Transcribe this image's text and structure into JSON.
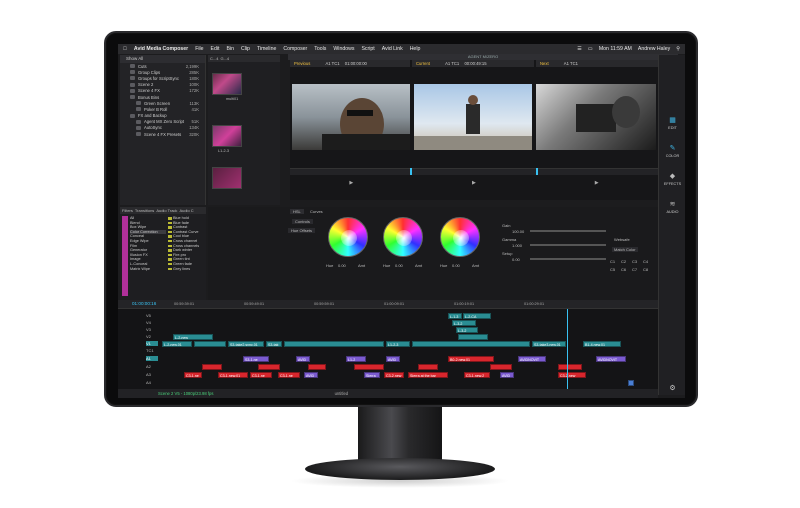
{
  "menu": {
    "app": "Avid Media Composer",
    "items": [
      "File",
      "Edit",
      "Bin",
      "Clip",
      "Timeline",
      "Composer",
      "Tools",
      "Windows",
      "Script",
      "Avid Link",
      "Help"
    ],
    "clock": "Mon 11:59 AM",
    "user": "Andrew Haley"
  },
  "window_title": "AGENT M/ZERO",
  "bin": {
    "header": "Show All",
    "rows": [
      {
        "name": "Cuts",
        "size": "2,199K"
      },
      {
        "name": "Group Clips",
        "size": "285K"
      },
      {
        "name": "Groups for ScriptSync",
        "size": "180K"
      },
      {
        "name": "Scene 2",
        "size": "100K"
      },
      {
        "name": "Scene 4 FX",
        "size": "172K"
      },
      {
        "name": "Bonus Bins",
        "size": ""
      },
      {
        "name": "Green Screen",
        "size": "113K"
      },
      {
        "name": "Poker B Roll",
        "size": "41K"
      },
      {
        "name": "FX and Backup",
        "size": ""
      },
      {
        "name": "Agent MX Zero Script",
        "size": "51K"
      },
      {
        "name": "AutoSync",
        "size": "134K"
      },
      {
        "name": "Scene 4 FX Presets",
        "size": "320K"
      }
    ]
  },
  "thumbs": {
    "tabs": [
      "C...4",
      "G...4"
    ],
    "labels": [
      "multi01",
      "L1-2-3"
    ]
  },
  "viewers": {
    "left_title": "Previous",
    "left_track": "A1  TC1",
    "left_tc": "01:00:00:00",
    "center_title": "Current",
    "center_track": "A1  TC1",
    "center_tc": "00:00:49:15",
    "right_title": "Next",
    "right_track": "A1  TC1"
  },
  "sidebar": [
    {
      "icon": "edit-icon",
      "label": "EDIT"
    },
    {
      "icon": "color-icon",
      "label": "COLOR"
    },
    {
      "icon": "effects-icon",
      "label": "EFFECTS"
    },
    {
      "icon": "audio-icon",
      "label": "AUDIO"
    }
  ],
  "effects": {
    "tabs": [
      "Filters",
      "Transitions",
      "Audio Track",
      "Audio C"
    ],
    "categories": [
      "All",
      "Blend",
      "Box Wipe",
      "Color Correction",
      "Conceal",
      "Edge Wipe",
      "Film",
      "Generator",
      "Illusion FX",
      "Image",
      "L-Conceal",
      "Matrix Wipe"
    ],
    "filters": [
      "Blue hold",
      "Blue fade",
      "Contrast",
      "Contrast Curve",
      "Cool blue",
      "Cross channel",
      "Cross channels",
      "Dark winter",
      "Fire.pro",
      "Green tint",
      "Green fade",
      "Grey lines"
    ]
  },
  "color_correction": {
    "tab_hsl": "HSL",
    "tab_curves": "Curves",
    "btn_controls": "Controls",
    "btn_offsets": "Hue Offsets",
    "wheel_label": "Hue",
    "gain_label": "Gain",
    "gamma_label": "Gamma",
    "setup_label": "Setup",
    "gain_value": "100.00",
    "gamma_value": "1.000",
    "setup_value": "0.00",
    "wheel_values": [
      "0.00",
      "0.00",
      "0.00"
    ],
    "wheel_amt": "Amt",
    "match_label": "Match Color",
    "websafe_label": "Websafe",
    "swatches": [
      "C1",
      "C2",
      "C3",
      "C4",
      "C5",
      "C6",
      "C7",
      "C8"
    ]
  },
  "timeline": {
    "timecode": "01:00:00:16",
    "ruler": [
      "00:59:39:01",
      "00:59:49:01",
      "00:59:59:01",
      "01:00:09:01",
      "01:00:19:01",
      "01:00:29:01"
    ],
    "tracks": [
      "V5",
      "V4",
      "V3",
      "V2",
      "V1",
      "TC1",
      "A1",
      "A2",
      "A3",
      "A4"
    ],
    "status_text": "Scene 2 V5 - 1080p/23.98 fps",
    "status_right": "untitled"
  },
  "clips": {
    "v1_a": "L-2-new.01",
    "v1_b": "S3-take2.sync.01",
    "v1_c": "S3-tak",
    "v1_d": "L1-2-3",
    "v1_e": "S3-take3.new.01",
    "v1_f": "B1-4.new.01",
    "v2_a": "L-2-new",
    "v3_a": "L-3-2",
    "v4_a": "L-3-2",
    "v5_a": "L-1-3",
    "v5_b": "L-2-CA",
    "a1_a": "S3-1.ne",
    "a1_b": "AVID",
    "a1_c": "L1-2",
    "a1_d": "AVID",
    "a1_e": "B0-2.new.01",
    "a1_f": "AVIDNOVIT",
    "a1_g": "AVIDNOVIT",
    "a2_a": "C3-1.ne",
    "a2_b": "C3-1.new.01",
    "a2_c": "C3-1.ne",
    "a2_d": "C3-1.ne",
    "a2_e": "AVID",
    "a2_f": "Sierra",
    "a2_g": "C3-2.new",
    "a2_h": "Sierra at the bar",
    "a2_i": "C3-1.new.2",
    "a2_j": "AVID",
    "a2_k": "C3-2.new"
  }
}
